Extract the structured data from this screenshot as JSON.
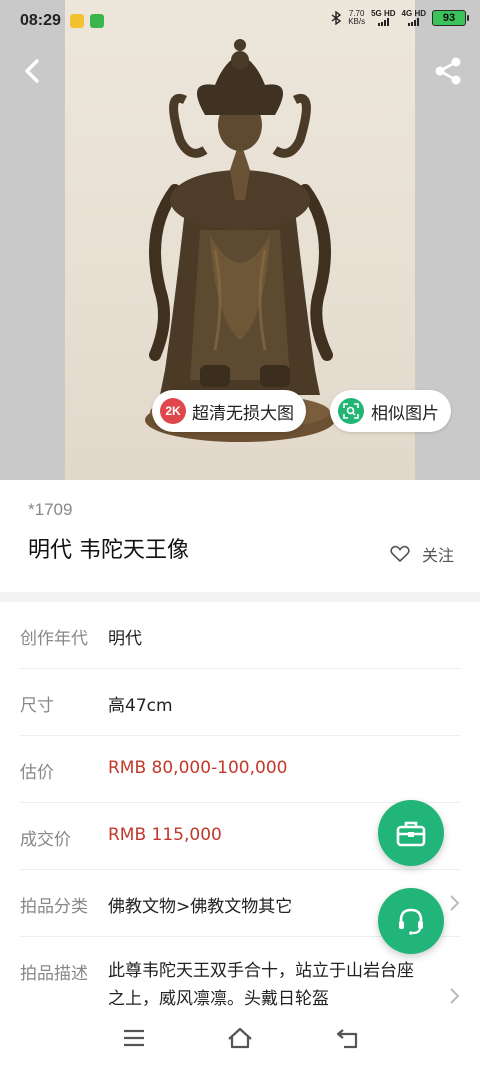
{
  "status_bar": {
    "time": "08:29",
    "speed_value": "7.70",
    "speed_unit": "KB/s",
    "sim1": "5G HD",
    "sim2": "4G HD",
    "battery": "93"
  },
  "image_actions": {
    "hd_badge": "2K",
    "hd_label": "超清无损大图",
    "similar_label": "相似图片"
  },
  "lot": {
    "number": "*1709",
    "title": "明代 韦陀天王像",
    "follow_label": "关注"
  },
  "details": [
    {
      "label": "创作年代",
      "value": "明代"
    },
    {
      "label": "尺寸",
      "value": "高47cm"
    },
    {
      "label": "估价",
      "value": "RMB  80,000-100,000"
    },
    {
      "label": "成交价",
      "value": "RMB 115,000"
    },
    {
      "label": "拍品分类",
      "value": "佛教文物>佛教文物其它"
    },
    {
      "label": "拍品描述",
      "value": "此尊韦陀天王双手合十，站立于山岩台座之上，威风凛凛。头戴日轮盔"
    }
  ],
  "colors": {
    "accent_green": "#21b57a",
    "price_red": "#c0392b",
    "badge_red": "#e0474c"
  },
  "icons": [
    "back-arrow-icon",
    "share-icon",
    "heart-outline-icon",
    "chevron-right-icon",
    "briefcase-icon",
    "headset-icon",
    "menu-icon",
    "home-icon",
    "return-icon"
  ]
}
